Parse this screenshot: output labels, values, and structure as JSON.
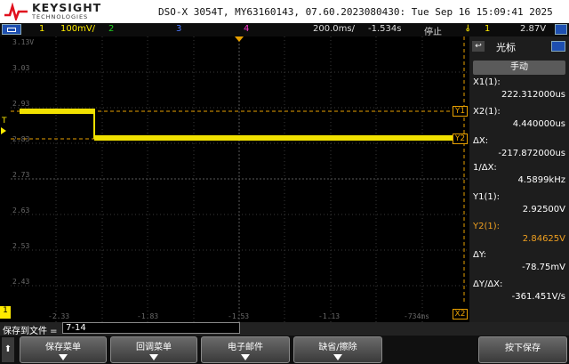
{
  "header": {
    "brand": "KEYSIGHT",
    "brand_sub": "TECHNOLOGIES",
    "device_info": "DSO-X 3054T, MY63160143, 07.60.2023080430: Tue Sep 16 15:09:41 2025"
  },
  "channel_bar": {
    "ch1_num": "1",
    "ch1_scale": "100mV/",
    "ch2_num": "2",
    "ch3_num": "3",
    "ch4_num": "4",
    "timebase": "200.0ms/",
    "delay": "-1.534s",
    "run_state": "停止",
    "trigger_icon": "trigger-rising-edge-icon",
    "trigger_channel": "1",
    "trigger_level": "2.87V"
  },
  "screen": {
    "volt_labels": [
      "3.13V",
      "3.03",
      "2.93",
      "2.83",
      "2.73",
      "2.63",
      "2.53",
      "2.43"
    ],
    "time_labels": [
      "-2.33",
      "-1.83",
      "-1.53",
      "-1.13",
      "-734ms"
    ],
    "cursor_x2_label": "X2",
    "cursor_y1_label": "Y1",
    "cursor_y2_label": "Y2",
    "trigger_marker": "T",
    "ground_marker": "1",
    "trace_color": "#f0e000",
    "cursor_color": "#e8a000"
  },
  "side_panel": {
    "title": "光标",
    "mode_button": "手动",
    "x1_label": "X1(1):",
    "x1_value": "222.312000us",
    "x2_label": "X2(1):",
    "x2_value": "4.440000us",
    "dx_label": "ΔX:",
    "dx_value": "-217.872000us",
    "inv_dx_label": "1/ΔX:",
    "inv_dx_value": "4.5899kHz",
    "y1_label": "Y1(1):",
    "y1_value": "2.92500V",
    "y2_label": "Y2(1):",
    "y2_value": "2.84625V",
    "dy_label": "ΔY:",
    "dy_value": "-78.75mV",
    "dy_dx_label": "ΔY/ΔX:",
    "dy_dx_value": "-361.451V/s"
  },
  "softkeys": {
    "save_to_label": "保存到文件 =",
    "save_to_value": "7-14",
    "save_menu": "保存菜单",
    "recall_menu": "回调菜单",
    "email": "电子邮件",
    "default_erase": "缺省/擦除",
    "press_save": "按下保存"
  }
}
